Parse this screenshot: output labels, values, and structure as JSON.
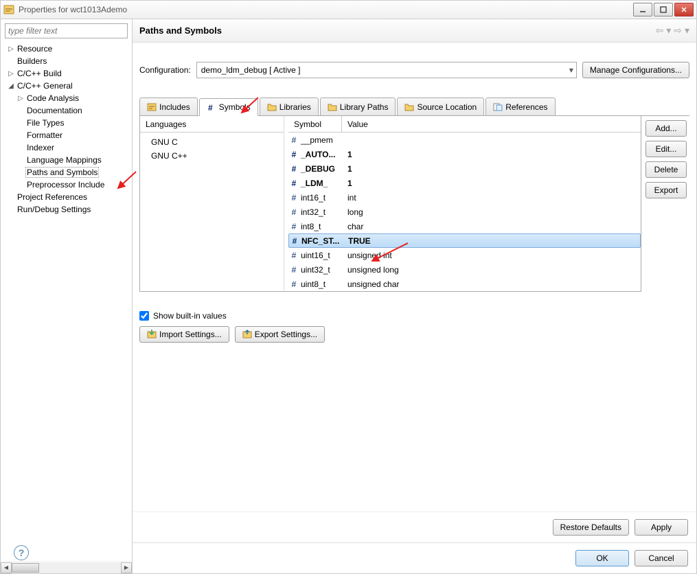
{
  "window": {
    "title": "Properties for wct1013Ademo"
  },
  "filter_placeholder": "type filter text",
  "tree": [
    {
      "label": "Resource",
      "indent": 0,
      "tw": "▷"
    },
    {
      "label": "Builders",
      "indent": 0,
      "tw": ""
    },
    {
      "label": "C/C++ Build",
      "indent": 0,
      "tw": "▷"
    },
    {
      "label": "C/C++ General",
      "indent": 0,
      "tw": "◢"
    },
    {
      "label": "Code Analysis",
      "indent": 1,
      "tw": "▷"
    },
    {
      "label": "Documentation",
      "indent": 1,
      "tw": ""
    },
    {
      "label": "File Types",
      "indent": 1,
      "tw": ""
    },
    {
      "label": "Formatter",
      "indent": 1,
      "tw": ""
    },
    {
      "label": "Indexer",
      "indent": 1,
      "tw": ""
    },
    {
      "label": "Language Mappings",
      "indent": 1,
      "tw": ""
    },
    {
      "label": "Paths and Symbols",
      "indent": 1,
      "tw": "",
      "selected": true
    },
    {
      "label": "Preprocessor Include",
      "indent": 1,
      "tw": ""
    },
    {
      "label": "Project References",
      "indent": 0,
      "tw": ""
    },
    {
      "label": "Run/Debug Settings",
      "indent": 0,
      "tw": ""
    }
  ],
  "header": {
    "title": "Paths and Symbols"
  },
  "config": {
    "label": "Configuration:",
    "selected": "demo_ldm_debug  [ Active ]",
    "manage": "Manage Configurations..."
  },
  "tabs": [
    {
      "label": "Includes",
      "icon": "includes-icon"
    },
    {
      "label": "Symbols",
      "icon": "hash-icon",
      "active": true
    },
    {
      "label": "Libraries",
      "icon": "folder-icon"
    },
    {
      "label": "Library Paths",
      "icon": "folder-icon"
    },
    {
      "label": "Source Location",
      "icon": "folder-icon"
    },
    {
      "label": "References",
      "icon": "refs-icon"
    }
  ],
  "panel": {
    "languages_header": "Languages",
    "languages": [
      "GNU C",
      "GNU C++"
    ],
    "symbol_header": "Symbol",
    "value_header": "Value",
    "symbols": [
      {
        "name": "__pmem",
        "value": "",
        "bold": false
      },
      {
        "name": "_AUTO...",
        "value": "1",
        "bold": true
      },
      {
        "name": "_DEBUG",
        "value": "1",
        "bold": true
      },
      {
        "name": "_LDM_",
        "value": "1",
        "bold": true
      },
      {
        "name": "int16_t",
        "value": "int",
        "bold": false
      },
      {
        "name": "int32_t",
        "value": "long",
        "bold": false
      },
      {
        "name": "int8_t",
        "value": "char",
        "bold": false
      },
      {
        "name": "NFC_ST...",
        "value": "TRUE",
        "bold": true,
        "selected": true
      },
      {
        "name": "uint16_t",
        "value": "unsigned int",
        "bold": false
      },
      {
        "name": "uint32_t",
        "value": "unsigned long",
        "bold": false
      },
      {
        "name": "uint8_t",
        "value": "unsigned char",
        "bold": false
      }
    ]
  },
  "actions": {
    "add": "Add...",
    "edit": "Edit...",
    "delete": "Delete",
    "export": "Export"
  },
  "below": {
    "show_builtin": "Show built-in values",
    "import": "Import Settings...",
    "export": "Export Settings..."
  },
  "footer": {
    "restore": "Restore Defaults",
    "apply": "Apply",
    "ok": "OK",
    "cancel": "Cancel"
  },
  "hash_glyph": "#"
}
